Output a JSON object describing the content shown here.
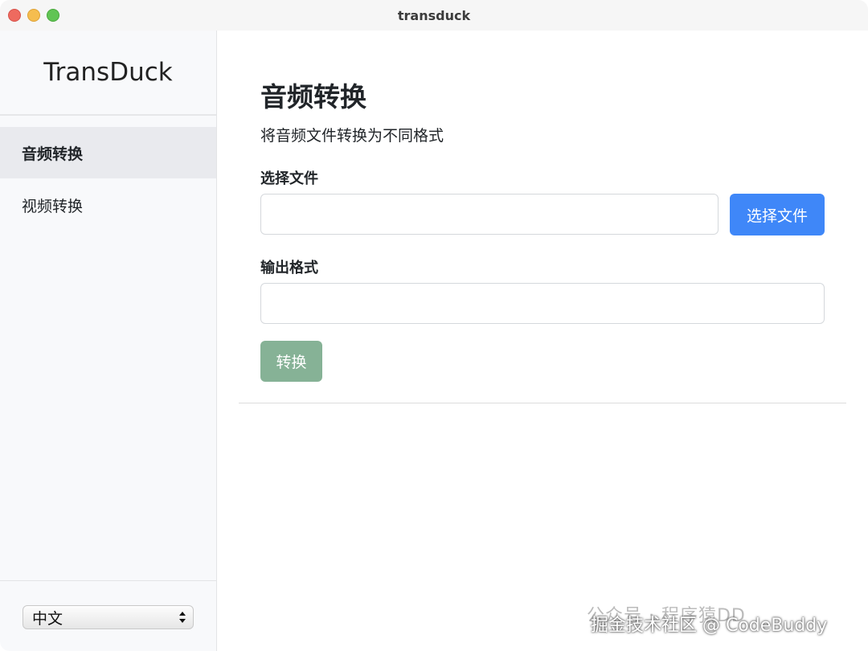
{
  "window": {
    "title": "transduck"
  },
  "sidebar": {
    "brand": "TransDuck",
    "items": [
      {
        "label": "音频转换",
        "active": true
      },
      {
        "label": "视频转换",
        "active": false
      }
    ],
    "language": {
      "selected": "中文"
    }
  },
  "main": {
    "title": "音频转换",
    "description": "将音频文件转换为不同格式",
    "file_label": "选择文件",
    "file_input_value": "",
    "choose_file_button": "选择文件",
    "format_label": "输出格式",
    "format_input_value": "",
    "convert_button": "转换"
  },
  "watermark": {
    "line1": "公众号 · 程序猿DD",
    "line2": "掘金技术社区 @ CodeBuddy"
  },
  "colors": {
    "primary": "#3f87f8",
    "convert_disabled": "#86b296",
    "sidebar_bg": "#f8f9fb",
    "active_item_bg": "#e9eaee"
  }
}
